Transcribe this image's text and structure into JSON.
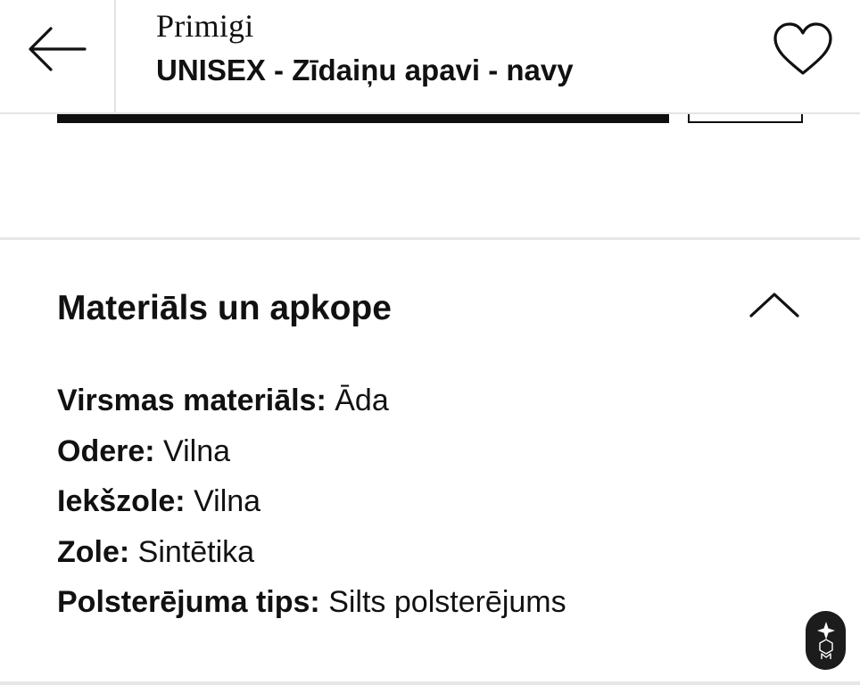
{
  "header": {
    "back_icon": "arrow-left-icon",
    "brand": "Primigi",
    "product_title": "UNISEX - Zīdaiņu apavi - navy",
    "wishlist_icon": "heart-icon"
  },
  "accordion": {
    "title": "Materiāls un apkope",
    "toggle_icon": "chevron-up-icon",
    "expanded": true,
    "attributes": [
      {
        "label": "Virsmas materiāls:",
        "value": "Āda"
      },
      {
        "label": "Odere:",
        "value": "Vilna"
      },
      {
        "label": "Iekšzole:",
        "value": "Vilna"
      },
      {
        "label": "Zole:",
        "value": "Sintētika"
      },
      {
        "label": "Polsterējuma tips:",
        "value": "Silts polsterējums"
      }
    ]
  },
  "floating_badge": {
    "icon": "sparkle-logo-icon"
  },
  "colors": {
    "text": "#111111",
    "divider": "#e6e6e6",
    "primary_button": "#0f0f0f",
    "badge_background": "#1c1c1c"
  }
}
